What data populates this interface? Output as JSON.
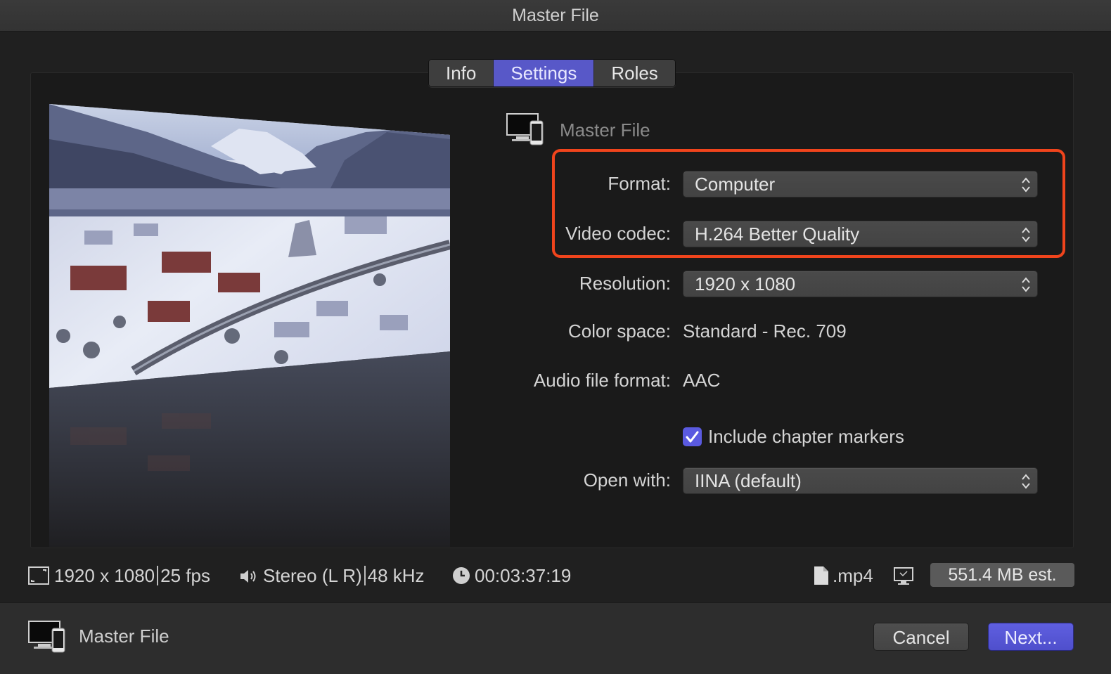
{
  "window": {
    "title": "Master File"
  },
  "tabs": [
    {
      "label": "Info",
      "active": false
    },
    {
      "label": "Settings",
      "active": true
    },
    {
      "label": "Roles",
      "active": false
    }
  ],
  "settings": {
    "destination_name": "Master File",
    "format": {
      "label": "Format:",
      "value": "Computer"
    },
    "video_codec": {
      "label": "Video codec:",
      "value": "H.264 Better Quality"
    },
    "resolution": {
      "label": "Resolution:",
      "value": "1920 x 1080"
    },
    "color_space": {
      "label": "Color space:",
      "value": "Standard - Rec. 709"
    },
    "audio_file_format": {
      "label": "Audio file format:",
      "value": "AAC"
    },
    "chapter_markers": {
      "label": "Include chapter markers",
      "checked": true
    },
    "open_with": {
      "label": "Open with:",
      "value": "IINA (default)"
    }
  },
  "status": {
    "resolution": "1920 x 1080",
    "fps": "25 fps",
    "audio_channels": "Stereo (L R)",
    "sample_rate": "48 kHz",
    "duration": "00:03:37:19",
    "extension": ".mp4",
    "size_estimate": "551.4 MB est."
  },
  "footer": {
    "destination_name": "Master File",
    "cancel_label": "Cancel",
    "next_label": "Next..."
  },
  "colors": {
    "accent": "#5858c8",
    "highlight_border": "#f0441c"
  }
}
